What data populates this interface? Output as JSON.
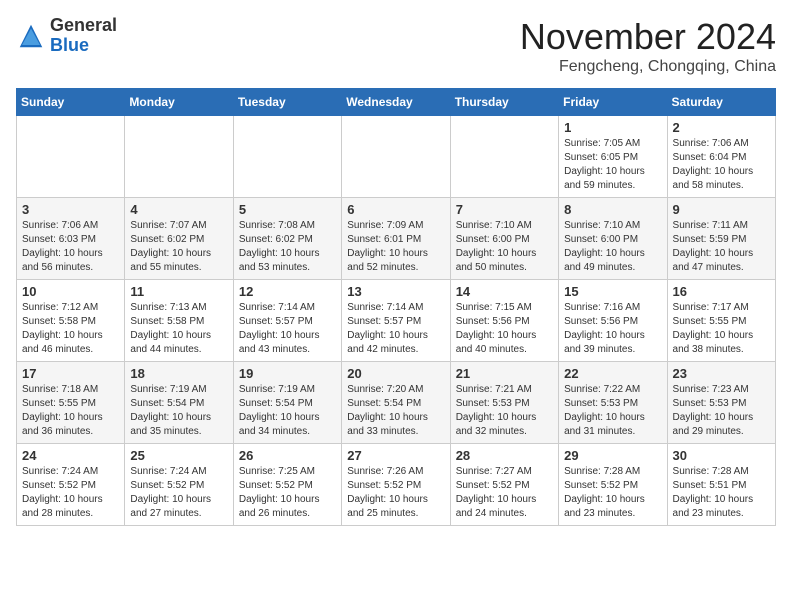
{
  "header": {
    "logo_general": "General",
    "logo_blue": "Blue",
    "month_title": "November 2024",
    "subtitle": "Fengcheng, Chongqing, China"
  },
  "days_of_week": [
    "Sunday",
    "Monday",
    "Tuesday",
    "Wednesday",
    "Thursday",
    "Friday",
    "Saturday"
  ],
  "weeks": [
    [
      {
        "day": "",
        "info": ""
      },
      {
        "day": "",
        "info": ""
      },
      {
        "day": "",
        "info": ""
      },
      {
        "day": "",
        "info": ""
      },
      {
        "day": "",
        "info": ""
      },
      {
        "day": "1",
        "info": "Sunrise: 7:05 AM\nSunset: 6:05 PM\nDaylight: 10 hours and 59 minutes."
      },
      {
        "day": "2",
        "info": "Sunrise: 7:06 AM\nSunset: 6:04 PM\nDaylight: 10 hours and 58 minutes."
      }
    ],
    [
      {
        "day": "3",
        "info": "Sunrise: 7:06 AM\nSunset: 6:03 PM\nDaylight: 10 hours and 56 minutes."
      },
      {
        "day": "4",
        "info": "Sunrise: 7:07 AM\nSunset: 6:02 PM\nDaylight: 10 hours and 55 minutes."
      },
      {
        "day": "5",
        "info": "Sunrise: 7:08 AM\nSunset: 6:02 PM\nDaylight: 10 hours and 53 minutes."
      },
      {
        "day": "6",
        "info": "Sunrise: 7:09 AM\nSunset: 6:01 PM\nDaylight: 10 hours and 52 minutes."
      },
      {
        "day": "7",
        "info": "Sunrise: 7:10 AM\nSunset: 6:00 PM\nDaylight: 10 hours and 50 minutes."
      },
      {
        "day": "8",
        "info": "Sunrise: 7:10 AM\nSunset: 6:00 PM\nDaylight: 10 hours and 49 minutes."
      },
      {
        "day": "9",
        "info": "Sunrise: 7:11 AM\nSunset: 5:59 PM\nDaylight: 10 hours and 47 minutes."
      }
    ],
    [
      {
        "day": "10",
        "info": "Sunrise: 7:12 AM\nSunset: 5:58 PM\nDaylight: 10 hours and 46 minutes."
      },
      {
        "day": "11",
        "info": "Sunrise: 7:13 AM\nSunset: 5:58 PM\nDaylight: 10 hours and 44 minutes."
      },
      {
        "day": "12",
        "info": "Sunrise: 7:14 AM\nSunset: 5:57 PM\nDaylight: 10 hours and 43 minutes."
      },
      {
        "day": "13",
        "info": "Sunrise: 7:14 AM\nSunset: 5:57 PM\nDaylight: 10 hours and 42 minutes."
      },
      {
        "day": "14",
        "info": "Sunrise: 7:15 AM\nSunset: 5:56 PM\nDaylight: 10 hours and 40 minutes."
      },
      {
        "day": "15",
        "info": "Sunrise: 7:16 AM\nSunset: 5:56 PM\nDaylight: 10 hours and 39 minutes."
      },
      {
        "day": "16",
        "info": "Sunrise: 7:17 AM\nSunset: 5:55 PM\nDaylight: 10 hours and 38 minutes."
      }
    ],
    [
      {
        "day": "17",
        "info": "Sunrise: 7:18 AM\nSunset: 5:55 PM\nDaylight: 10 hours and 36 minutes."
      },
      {
        "day": "18",
        "info": "Sunrise: 7:19 AM\nSunset: 5:54 PM\nDaylight: 10 hours and 35 minutes."
      },
      {
        "day": "19",
        "info": "Sunrise: 7:19 AM\nSunset: 5:54 PM\nDaylight: 10 hours and 34 minutes."
      },
      {
        "day": "20",
        "info": "Sunrise: 7:20 AM\nSunset: 5:54 PM\nDaylight: 10 hours and 33 minutes."
      },
      {
        "day": "21",
        "info": "Sunrise: 7:21 AM\nSunset: 5:53 PM\nDaylight: 10 hours and 32 minutes."
      },
      {
        "day": "22",
        "info": "Sunrise: 7:22 AM\nSunset: 5:53 PM\nDaylight: 10 hours and 31 minutes."
      },
      {
        "day": "23",
        "info": "Sunrise: 7:23 AM\nSunset: 5:53 PM\nDaylight: 10 hours and 29 minutes."
      }
    ],
    [
      {
        "day": "24",
        "info": "Sunrise: 7:24 AM\nSunset: 5:52 PM\nDaylight: 10 hours and 28 minutes."
      },
      {
        "day": "25",
        "info": "Sunrise: 7:24 AM\nSunset: 5:52 PM\nDaylight: 10 hours and 27 minutes."
      },
      {
        "day": "26",
        "info": "Sunrise: 7:25 AM\nSunset: 5:52 PM\nDaylight: 10 hours and 26 minutes."
      },
      {
        "day": "27",
        "info": "Sunrise: 7:26 AM\nSunset: 5:52 PM\nDaylight: 10 hours and 25 minutes."
      },
      {
        "day": "28",
        "info": "Sunrise: 7:27 AM\nSunset: 5:52 PM\nDaylight: 10 hours and 24 minutes."
      },
      {
        "day": "29",
        "info": "Sunrise: 7:28 AM\nSunset: 5:52 PM\nDaylight: 10 hours and 23 minutes."
      },
      {
        "day": "30",
        "info": "Sunrise: 7:28 AM\nSunset: 5:51 PM\nDaylight: 10 hours and 23 minutes."
      }
    ]
  ]
}
